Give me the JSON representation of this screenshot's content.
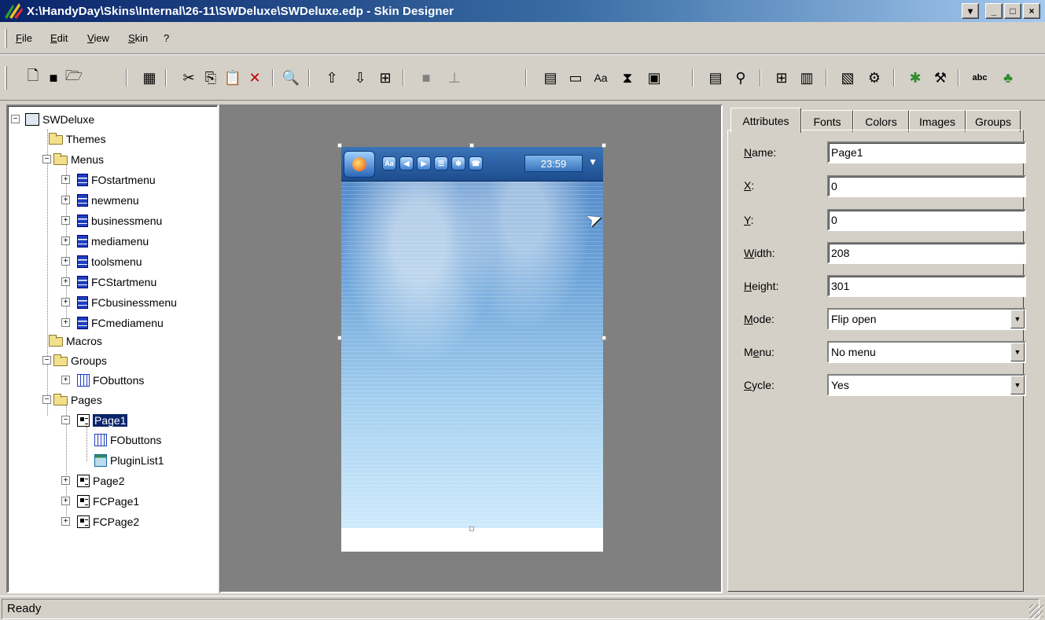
{
  "window": {
    "title": "X:\\HandyDay\\Skins\\Internal\\26-11\\SWDeluxe\\SWDeluxe.edp - Skin Designer",
    "controls": [
      "restore-mdi",
      "minimize",
      "maximize",
      "close"
    ]
  },
  "menu": {
    "items": [
      {
        "label": "File",
        "mnemonic": "F"
      },
      {
        "label": "Edit",
        "mnemonic": "E"
      },
      {
        "label": "View",
        "mnemonic": "V"
      },
      {
        "label": "Skin",
        "mnemonic": "S"
      },
      {
        "label": "?",
        "mnemonic": ""
      }
    ]
  },
  "toolbar": {
    "buttons": [
      "new-file-icon",
      "save-icon",
      "open-folder-icon",
      "calculator-icon",
      "cut-icon",
      "copy-icon",
      "paste-icon",
      "delete-icon",
      "zoom-icon",
      "move-up-icon",
      "move-down-icon",
      "fit-icon",
      "fill-icon",
      "align-icon",
      "add-page-icon",
      "add-folder-icon",
      "add-font-icon",
      "add-hourglass-icon",
      "add-image-icon",
      "add-item-icon",
      "add-link-icon",
      "add-group-icon",
      "add-list-icon",
      "add-picture-icon",
      "add-effect-icon",
      "add-star-icon",
      "add-tools-icon",
      "spell-check-icon",
      "plant-icon"
    ]
  },
  "tree": {
    "root": "SWDeluxe",
    "nodes": {
      "themes": "Themes",
      "menus": "Menus",
      "menu_items": [
        "FOstartmenu",
        "newmenu",
        "businessmenu",
        "mediamenu",
        "toolsmenu",
        "FCStartmenu",
        "FCbusinessmenu",
        "FCmediamenu"
      ],
      "macros": "Macros",
      "groups": "Groups",
      "group_items": [
        "FObuttons"
      ],
      "pages": "Pages",
      "page1": "Page1",
      "page1_children": [
        "FObuttons",
        "PluginList1"
      ],
      "other_pages": [
        "Page2",
        "FCPage1",
        "FCPage2"
      ]
    },
    "selected": "Page1"
  },
  "canvas": {
    "clock": "23:59",
    "small_button_labels": [
      "Aa",
      "◀",
      "▶",
      "☰",
      "✱",
      "☎"
    ]
  },
  "properties": {
    "tabs": [
      "Attributes",
      "Fonts",
      "Colors",
      "Images",
      "Groups"
    ],
    "active_tab": "Attributes",
    "fields": {
      "name": {
        "label": "Name:",
        "value": "Page1"
      },
      "x": {
        "label": "X:",
        "value": "0"
      },
      "y": {
        "label": "Y:",
        "value": "0"
      },
      "width": {
        "label": "Width:",
        "value": "208"
      },
      "height": {
        "label": "Height:",
        "value": "301"
      },
      "mode": {
        "label": "Mode:",
        "value": "Flip open"
      },
      "menu": {
        "label": "Menu:",
        "value": "No menu"
      },
      "cycle": {
        "label": "Cycle:",
        "value": "Yes"
      }
    }
  },
  "status": {
    "text": "Ready"
  }
}
